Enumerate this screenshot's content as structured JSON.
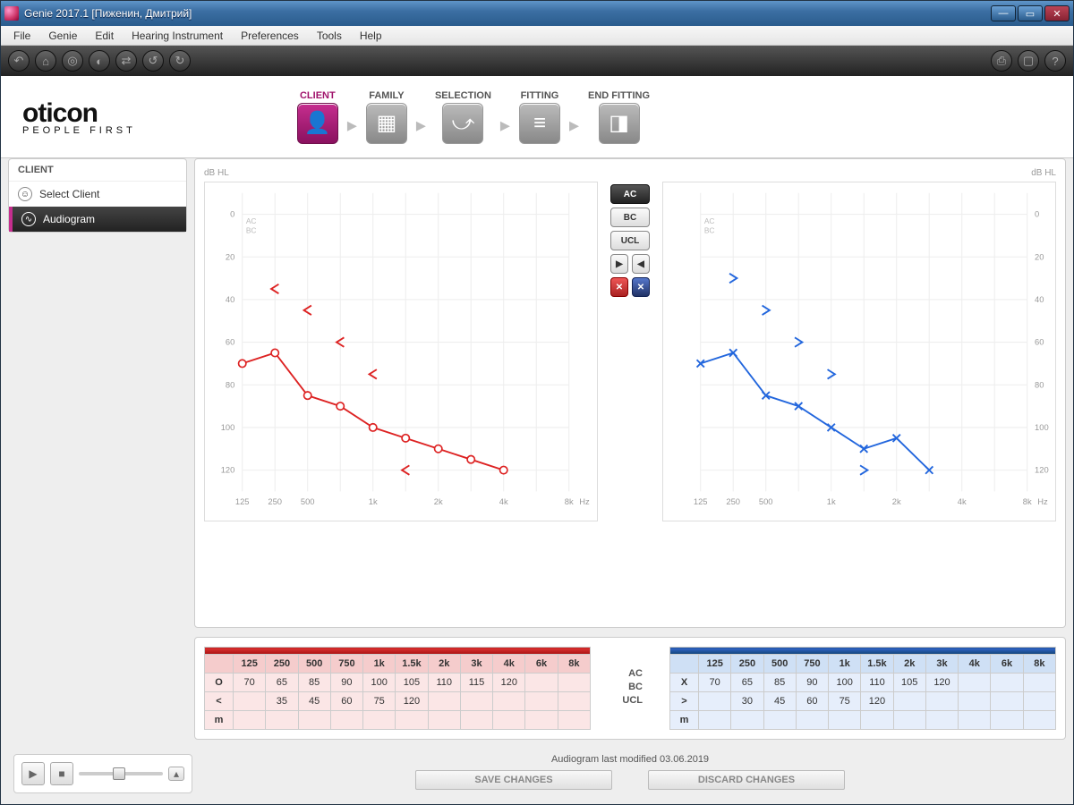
{
  "window": {
    "title": "Genie 2017.1 [Пиженин, Дмитрий]"
  },
  "menu": [
    "File",
    "Genie",
    "Edit",
    "Hearing Instrument",
    "Preferences",
    "Tools",
    "Help"
  ],
  "workflow": [
    {
      "label": "CLIENT",
      "icon": "user-icon",
      "active": true
    },
    {
      "label": "FAMILY",
      "icon": "grid-icon"
    },
    {
      "label": "SELECTION",
      "icon": "curve-icon"
    },
    {
      "label": "FITTING",
      "icon": "sliders-icon"
    },
    {
      "label": "END FITTING",
      "icon": "door-icon"
    }
  ],
  "brand": {
    "name": "oticon",
    "tag": "PEOPLE FIRST"
  },
  "sidebar": {
    "title": "CLIENT",
    "items": [
      {
        "icon": "person-outline-icon",
        "label": "Select Client"
      },
      {
        "icon": "audiogram-icon",
        "label": "Audiogram",
        "active": true
      }
    ]
  },
  "midbuttons": {
    "ac": "AC",
    "bc": "BC",
    "ucl": "UCL"
  },
  "axis": {
    "ylabel": "dB HL",
    "xlabel": "Hz",
    "ac": "AC",
    "bc": "BC"
  },
  "tables": {
    "headers": [
      "125",
      "250",
      "500",
      "750",
      "1k",
      "1.5k",
      "2k",
      "3k",
      "4k",
      "6k",
      "8k"
    ],
    "rowlabels": [
      "AC",
      "BC",
      "UCL"
    ],
    "left": {
      "symbols": [
        "O",
        "<",
        "m"
      ],
      "ac": [
        "70",
        "65",
        "85",
        "90",
        "100",
        "105",
        "110",
        "115",
        "120",
        "",
        ""
      ],
      "bc": [
        "",
        "35",
        "45",
        "60",
        "75",
        "120",
        "",
        "",
        "",
        "",
        ""
      ],
      "ucl": [
        "",
        "",
        "",
        "",
        "",
        "",
        "",
        "",
        "",
        "",
        ""
      ]
    },
    "right": {
      "symbols": [
        "X",
        ">",
        "m"
      ],
      "ac": [
        "70",
        "65",
        "85",
        "90",
        "100",
        "110",
        "105",
        "120",
        "",
        "",
        ""
      ],
      "bc": [
        "",
        "30",
        "45",
        "60",
        "75",
        "120",
        "",
        "",
        "",
        "",
        ""
      ],
      "ucl": [
        "",
        "",
        "",
        "",
        "",
        "",
        "",
        "",
        "",
        "",
        ""
      ]
    }
  },
  "footer": {
    "modified": "Audiogram last modified 03.06.2019",
    "save": "SAVE CHANGES",
    "discard": "DISCARD CHANGES"
  },
  "chart_data": [
    {
      "type": "line",
      "title": "Right ear audiogram (red)",
      "ylabel": "dB HL",
      "xlabel": "Hz",
      "categories": [
        "125",
        "250",
        "500",
        "750",
        "1k",
        "1.5k",
        "2k",
        "3k",
        "4k",
        "6k",
        "8k"
      ],
      "ylim": [
        -10,
        130
      ],
      "series": [
        {
          "name": "AC (O)",
          "values": [
            70,
            65,
            85,
            90,
            100,
            105,
            110,
            115,
            120,
            null,
            null
          ]
        },
        {
          "name": "BC (<)",
          "values": [
            null,
            35,
            45,
            60,
            75,
            120,
            null,
            null,
            null,
            null,
            null
          ]
        }
      ]
    },
    {
      "type": "line",
      "title": "Left ear audiogram (blue)",
      "ylabel": "dB HL",
      "xlabel": "Hz",
      "categories": [
        "125",
        "250",
        "500",
        "750",
        "1k",
        "1.5k",
        "2k",
        "3k",
        "4k",
        "6k",
        "8k"
      ],
      "ylim": [
        -10,
        130
      ],
      "series": [
        {
          "name": "AC (X)",
          "values": [
            70,
            65,
            85,
            90,
            100,
            110,
            105,
            120,
            null,
            null,
            null
          ]
        },
        {
          "name": "BC (>)",
          "values": [
            null,
            30,
            45,
            60,
            75,
            120,
            null,
            null,
            null,
            null,
            null
          ]
        }
      ]
    }
  ]
}
